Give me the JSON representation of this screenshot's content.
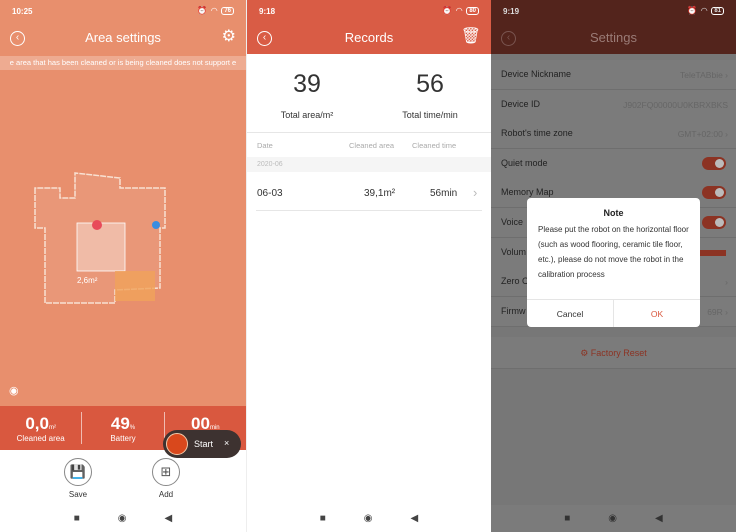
{
  "area_settings": {
    "status": {
      "time": "10:25",
      "battery": "76"
    },
    "title": "Area settings",
    "banner": "e area that has been cleaned or is being cleaned does not support e",
    "map": {
      "area_label": "2,6m²"
    },
    "stats": [
      {
        "value": "0,0",
        "unit": "m²",
        "label": "Cleaned area"
      },
      {
        "value": "49",
        "unit": "%",
        "label": "Battery"
      },
      {
        "value": "00",
        "unit": "min",
        "label": ""
      }
    ],
    "start_pill": {
      "label": "Start",
      "close": "×"
    },
    "actions": {
      "save": "Save",
      "add": "Add"
    }
  },
  "records": {
    "status": {
      "time": "9:18",
      "battery": "80"
    },
    "title": "Records",
    "total_area": "39",
    "total_area_label": "Total area/m²",
    "total_time": "56",
    "total_time_label": "Total time/min",
    "columns": [
      "Date",
      "Cleaned area",
      "Cleaned time"
    ],
    "group": "2020-06",
    "rows": [
      {
        "date": "06-03",
        "area": "39,1m²",
        "time": "56min"
      }
    ]
  },
  "settings": {
    "status": {
      "time": "9:19",
      "battery": "81"
    },
    "title": "Settings",
    "rows": [
      {
        "label": "Device Nickname",
        "value": "TeleTABbie ›"
      },
      {
        "label": "Device ID",
        "value": "J902FQ00000U0KBRXBKS"
      },
      {
        "label": "Robot's time zone",
        "value": "GMT+02:00 ›"
      },
      {
        "label": "Quiet mode",
        "toggle": true
      },
      {
        "label": "Memory Map",
        "toggle": true
      },
      {
        "label": "Voice",
        "toggle": true
      },
      {
        "label": "Volum"
      },
      {
        "label": "Zero C",
        "value": "›"
      },
      {
        "label": "Firmw",
        "value": "69R ›"
      }
    ],
    "factory_reset": "Factory Reset",
    "dialog": {
      "title": "Note",
      "body": "Please put the robot on the horizontal floor (such as wood flooring, ceramic tile floor, etc.), please do not move the robot in the calibration process",
      "cancel": "Cancel",
      "ok": "OK"
    }
  },
  "colors": {
    "accent": "#d95c45",
    "map_bg": "#e88f6d",
    "dim_header": "#53241c"
  }
}
